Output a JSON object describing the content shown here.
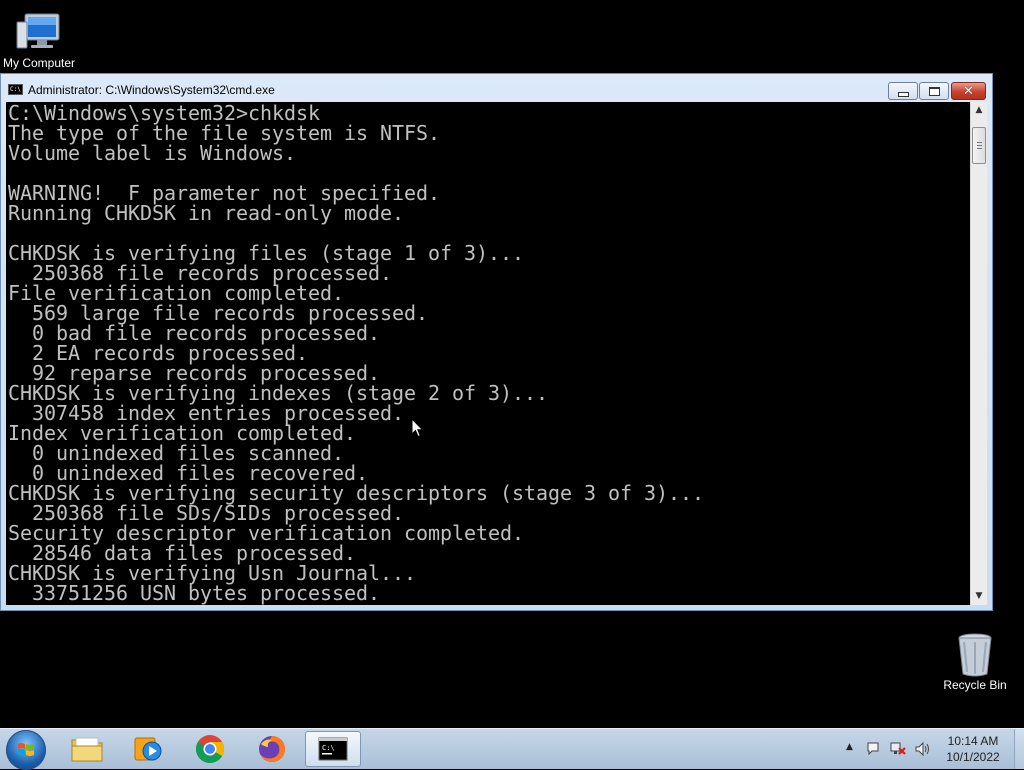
{
  "desktop": {
    "icons": [
      {
        "label": "My Computer",
        "icon": "computer-icon"
      },
      {
        "label": "Recycle Bin",
        "icon": "recycle-bin-icon"
      }
    ]
  },
  "window": {
    "title": "Administrator: C:\\Windows\\System32\\cmd.exe",
    "icon_text": "C:\\",
    "console_lines": [
      "C:\\Windows\\system32>chkdsk",
      "The type of the file system is NTFS.",
      "Volume label is Windows.",
      "",
      "WARNING!  F parameter not specified.",
      "Running CHKDSK in read-only mode.",
      "",
      "CHKDSK is verifying files (stage 1 of 3)...",
      "  250368 file records processed.",
      "File verification completed.",
      "  569 large file records processed.",
      "  0 bad file records processed.",
      "  2 EA records processed.",
      "  92 reparse records processed.",
      "CHKDSK is verifying indexes (stage 2 of 3)...",
      "  307458 index entries processed.",
      "Index verification completed.",
      "  0 unindexed files scanned.",
      "  0 unindexed files recovered.",
      "CHKDSK is verifying security descriptors (stage 3 of 3)...",
      "  250368 file SDs/SIDs processed.",
      "Security descriptor verification completed.",
      "  28546 data files processed.",
      "CHKDSK is verifying Usn Journal...",
      "  33751256 USN bytes processed."
    ]
  },
  "taskbar": {
    "items": [
      {
        "name": "windows-explorer",
        "icon": "folder-icon"
      },
      {
        "name": "media-player",
        "icon": "media-player-icon"
      },
      {
        "name": "chrome",
        "icon": "chrome-icon"
      },
      {
        "name": "firefox",
        "icon": "firefox-icon"
      },
      {
        "name": "cmd",
        "icon": "cmd-icon",
        "active": true
      }
    ],
    "clock": {
      "time": "10:14 AM",
      "date": "10/1/2022"
    }
  }
}
